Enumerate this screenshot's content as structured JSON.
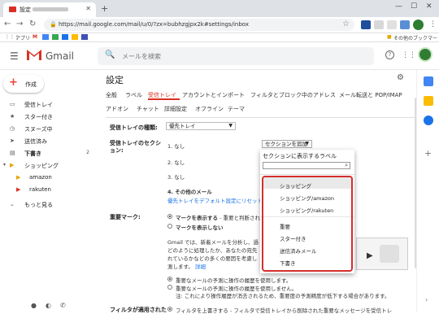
{
  "browser": {
    "tab_title": "設定 -",
    "url": "https://mail.google.com/mail/u/0/?zx=bubhzgjpx2k#settings/inbox",
    "bookmarks": {
      "apps": "アプリ",
      "other": "その他のブックマーク"
    }
  },
  "gmail": {
    "logo_text": "Gmail",
    "search_placeholder": "メールを検索",
    "compose": "作成"
  },
  "sidebar": {
    "items": [
      {
        "label": "受信トレイ",
        "icon": "inbox-icon",
        "count": ""
      },
      {
        "label": "スター付き",
        "icon": "star-icon",
        "count": ""
      },
      {
        "label": "スヌーズ中",
        "icon": "clock-icon",
        "count": ""
      },
      {
        "label": "送信済み",
        "icon": "send-icon",
        "count": ""
      },
      {
        "label": "下書き",
        "icon": "draft-icon",
        "count": "2"
      },
      {
        "label": "ショッピング",
        "icon": "label-icon",
        "count": ""
      },
      {
        "label": "amazon",
        "icon": "label-icon",
        "count": ""
      },
      {
        "label": "rakuten",
        "icon": "label-icon",
        "count": ""
      },
      {
        "label": "もっと見る",
        "icon": "chevron-down-icon",
        "count": ""
      }
    ]
  },
  "settings": {
    "title": "設定",
    "tabs_row1": [
      "全般",
      "ラベル",
      "受信トレイ",
      "アカウントとインポート",
      "フィルタとブロック中のアドレス",
      "メール転送と POP/IMAP"
    ],
    "tabs_row2": [
      "アドオン",
      "チャット",
      "詳細設定",
      "オフライン",
      "テーマ"
    ],
    "inbox_type_label": "受信トレイの種類:",
    "inbox_type_value": "優先トレイ",
    "sections_label": "受信トレイのセクション:",
    "sections": [
      "1. なし",
      "2. なし",
      "3. なし",
      "4. その他のメール"
    ],
    "add_section_button": "セクションを追加",
    "default_link": "優先トレイをデフォルト設定にリセット",
    "importance_label": "重要マーク:",
    "show_markers": "マークを表示する",
    "show_markers_tail": " - 重要と判断されたメールにマークを付けます。",
    "hide_markers": "マークを表示しない",
    "gmail_desc_1": "Gmail では、新着メールを分析し、過",
    "gmail_desc_2": "どのように処理したか、あなたの宛先",
    "gmail_desc_3": "れているかなどの多くの要因を考慮し",
    "gmail_desc_4": "測します。",
    "details_link": "詳細",
    "pred_1": "重要なメールの予測に操作の履歴を使用します。",
    "pred_2": "重要なメールの予測に操作の履歴を使用しません。",
    "pred_note": "注: これにより操作履歴が消去されるため、重要度の予測精度が低下する場合があります。",
    "filter_label": "フィルタが適用された",
    "filter_text": "フィルタを上書きする - フィルタで受信トレイから削除された重要なメッセージを受信トレ"
  },
  "dropdown": {
    "header": "セクションに表示するラベル",
    "items": [
      "ショッピング",
      "ショッピング/amazon",
      "ショッピング/rakuten",
      "重要",
      "スター付き",
      "送信済みメール",
      "下書き"
    ]
  },
  "colors": {
    "accent": "#d93025",
    "link": "#1a73e8",
    "highlight_border": "#d32f2f"
  }
}
